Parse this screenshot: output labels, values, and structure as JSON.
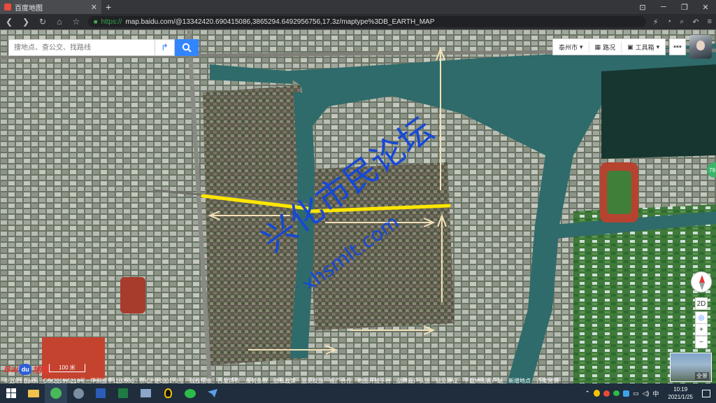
{
  "browser": {
    "tab_title": "百度地图",
    "tab_close": "✕",
    "new_tab": "+",
    "url_scheme": "https://",
    "url_rest": "map.baidu.com/@13342420.690415086,3865294.6492956756,17.3z/maptype%3DB_EARTH_MAP",
    "window_controls": [
      "⊡",
      "─",
      "❐",
      "✕"
    ]
  },
  "map": {
    "search": {
      "placeholder": "搜地点、查公交、找路线"
    },
    "toolbar": {
      "city": "泰州市",
      "traffic": "路况",
      "tools": "工具箱"
    },
    "side_badge": "79",
    "controls": {
      "view_2d": "2D",
      "zoom_in": "+",
      "zoom_out": "−"
    },
    "logo": {
      "part1": "Bai",
      "part2": "du",
      "part3": "地图"
    },
    "scale": "100 米",
    "panorama_label": "全景",
    "watermark": {
      "name": "兴化市民论坛",
      "site": "www.xhsmlt.com"
    }
  },
  "footer": {
    "copyright": "© 2021 Baidu - GS(2019)5218号 - 甲测资字1100930 - 京ICP证030173号",
    "links": [
      "版权信息",
      "百度首页",
      "服务条款",
      "隐私政策",
      "意见反馈",
      "推广合作",
      "地图开放平台",
      "品牌商户认领",
      "意见建议",
      "下载地图客户端",
      "新增地点",
      "百度营销"
    ]
  },
  "taskbar": {
    "time": "10:19",
    "date": "2021/1/25"
  },
  "colors": {
    "water": "#2f6b6b",
    "yellow_line": "#ffe600",
    "arrow": "#f3e2b8",
    "watermark": "#1748d6",
    "accent": "#3385ff"
  }
}
